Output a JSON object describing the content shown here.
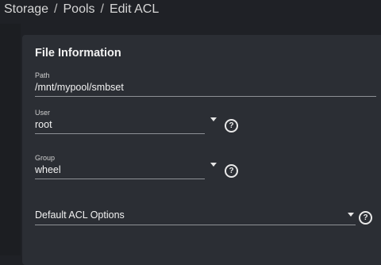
{
  "breadcrumb": {
    "items": [
      "Storage",
      "Pools",
      "Edit ACL"
    ],
    "separator": "/"
  },
  "card": {
    "title": "File Information",
    "path": {
      "label": "Path",
      "value": "/mnt/mypool/smbset"
    },
    "user": {
      "label": "User",
      "value": "root",
      "help_icon": "help-circle-icon",
      "help_glyph": "?"
    },
    "group": {
      "label": "Group",
      "value": "wheel",
      "help_icon": "help-circle-icon",
      "help_glyph": "?"
    },
    "acl_options": {
      "label": "Default ACL Options",
      "help_icon": "help-circle-icon",
      "help_glyph": "?"
    }
  },
  "colors": {
    "background": "#1f2126",
    "card": "#2b2e34",
    "text": "#f2f2f2",
    "underline": "#8e9196"
  }
}
